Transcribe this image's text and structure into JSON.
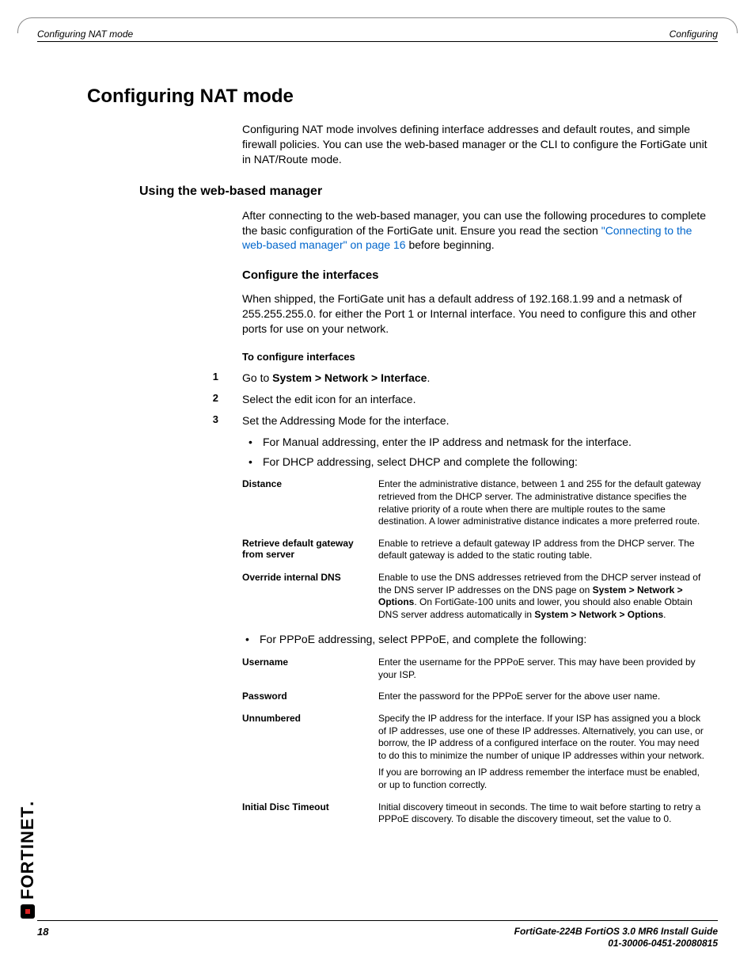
{
  "header": {
    "left": "Configuring NAT mode",
    "right": "Configuring"
  },
  "title": "Configuring NAT mode",
  "intro": "Configuring NAT mode involves defining interface addresses and default routes, and simple firewall policies. You can use the web-based manager or the CLI to configure the FortiGate unit in NAT/Route mode.",
  "section_webmanager": {
    "heading": "Using the web-based manager",
    "para_prefix": "After connecting to the web-based manager, you can use the following procedures to complete the basic configuration of the FortiGate unit. Ensure you read the section ",
    "link": "\"Connecting to the web-based manager\" on page 16",
    "para_suffix": " before beginning."
  },
  "section_interfaces": {
    "heading": "Configure the interfaces",
    "para": "When shipped, the FortiGate unit has a default address of 192.168.1.99 and a netmask of 255.255.255.0. for either the Port 1 or Internal interface. You need to configure this and other ports for use on your network.",
    "subheading": "To configure interfaces",
    "steps": [
      {
        "num": "1",
        "prefix": "Go to ",
        "bold": "System > Network > Interface",
        "suffix": "."
      },
      {
        "num": "2",
        "text": "Select the edit icon for an interface."
      },
      {
        "num": "3",
        "text": "Set the Addressing Mode for the interface."
      }
    ],
    "bullets_top": [
      "For Manual addressing, enter the IP address and netmask for the interface.",
      "For DHCP addressing, select DHCP and complete the following:"
    ],
    "dhcp_table": [
      {
        "term": "Distance",
        "desc": "Enter the administrative distance, between 1 and 255 for the default gateway retrieved from the DHCP server. The administrative distance specifies the relative priority of a route when there are multiple routes to the same destination. A lower administrative distance indicates a more preferred route."
      },
      {
        "term": "Retrieve default gateway from server",
        "desc": "Enable to retrieve a default gateway IP address from the DHCP server. The default gateway is added to the static routing table."
      },
      {
        "term": "Override internal DNS",
        "desc_parts": {
          "p1": "Enable to use the DNS addresses retrieved from the DHCP server instead of the DNS server IP addresses on the DNS page on ",
          "b1": "System > Network > Options",
          "p2": ". On FortiGate-100 units and lower, you should also enable Obtain DNS server address automatically in ",
          "b2": "System > Network > Options",
          "p3": "."
        }
      }
    ],
    "bullet_pppoe": "For PPPoE addressing, select PPPoE, and complete the following:",
    "pppoe_table": [
      {
        "term": "Username",
        "desc": "Enter the username for the PPPoE server. This may have been provided by your ISP."
      },
      {
        "term": "Password",
        "desc": "Enter the password for the PPPoE server for the above user name."
      },
      {
        "term": "Unnumbered",
        "desc": "Specify the IP address for the interface. If your ISP has assigned you a block of IP addresses, use one of these IP addresses. Alternatively, you can use, or borrow, the IP address of a configured interface on the router. You may need to do this to minimize the number of unique IP addresses within your network.",
        "extra": "If you are borrowing an IP address remember the interface must be enabled, or up to function correctly."
      },
      {
        "term": "Initial Disc Timeout",
        "desc": "Initial discovery timeout in seconds. The time to wait before starting to retry a PPPoE discovery. To disable the discovery timeout, set the value to 0."
      }
    ]
  },
  "footer": {
    "line1": "FortiGate-224B FortiOS 3.0 MR6 Install Guide",
    "line2": "01-30006-0451-20080815",
    "page": "18"
  },
  "logo_text": "FORTINET"
}
